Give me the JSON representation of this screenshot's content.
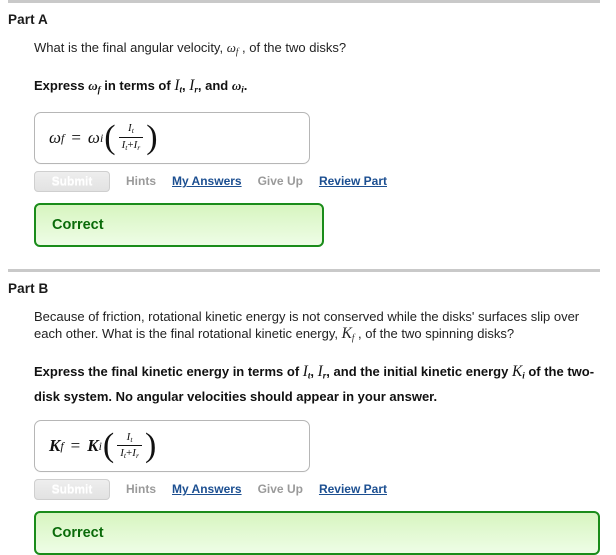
{
  "parts": [
    {
      "id": "part-a",
      "title": "Part A",
      "question_pre": "What is the final angular velocity, ",
      "question_var": "ω",
      "question_var_sub": "f",
      "question_post": " , of the two disks?",
      "instruction_pre": "Express ",
      "instruction_var1": "ω",
      "instruction_var1_sub": "f",
      "instruction_mid": " in terms of ",
      "instruction_var2": "I",
      "instruction_var2_sub": "t",
      "instruction_sep1": ", ",
      "instruction_var3": "I",
      "instruction_var3_sub": "r",
      "instruction_sep2": ", and ",
      "instruction_var4": "ω",
      "instruction_var4_sub": "i",
      "instruction_end": ".",
      "formula": {
        "lhs": "ω",
        "lhs_sub": "f",
        "equals": "=",
        "coefficient": "ω",
        "coefficient_sub": "i",
        "open_paren": "(",
        "numerator": "I",
        "numerator_sub": "t",
        "denominator_1": "I",
        "denominator_1_sub": "t",
        "denominator_plus": "+",
        "denominator_2": "I",
        "denominator_2_sub": "r",
        "close_paren": ")"
      },
      "actions": {
        "submit_label": "Submit",
        "hints_label": "Hints",
        "my_answers_label": "My Answers",
        "give_up_label": "Give Up",
        "review_part_label": "Review Part"
      },
      "feedback": "Correct"
    },
    {
      "id": "part-b",
      "title": "Part B",
      "question_pre": "Because of friction, rotational kinetic energy is not conserved while the disks' surfaces slip over each other. What is the final rotational kinetic energy, ",
      "question_var": "K",
      "question_var_sub": "f",
      "question_post": " , of the two spinning disks?",
      "instruction_pre": "Express the final kinetic energy in terms of ",
      "instruction_var2": "I",
      "instruction_var2_sub": "t",
      "instruction_sep1": ", ",
      "instruction_var3": "I",
      "instruction_var3_sub": "r",
      "instruction_sep2": ", and the initial kinetic energy ",
      "instruction_var4": "K",
      "instruction_var4_sub": "i",
      "instruction_end": " of the two-disk system. No angular velocities should appear in your answer.",
      "formula": {
        "lhs": "K",
        "lhs_sub": "f",
        "equals": "=",
        "coefficient": "K",
        "coefficient_sub": "i",
        "open_paren": "(",
        "numerator": "I",
        "numerator_sub": "t",
        "denominator_1": "I",
        "denominator_1_sub": "t",
        "denominator_plus": "+",
        "denominator_2": "I",
        "denominator_2_sub": "r",
        "close_paren": ")"
      },
      "actions": {
        "submit_label": "Submit",
        "hints_label": "Hints",
        "my_answers_label": "My Answers",
        "give_up_label": "Give Up",
        "review_part_label": "Review Part"
      },
      "feedback": "Correct"
    }
  ],
  "colors": {
    "link": "#1c4f91",
    "disabled_text": "#9a9a9a",
    "correct_border": "#1a8c1a",
    "correct_text": "#0a6b0a",
    "separator": "#c9c9c9"
  }
}
